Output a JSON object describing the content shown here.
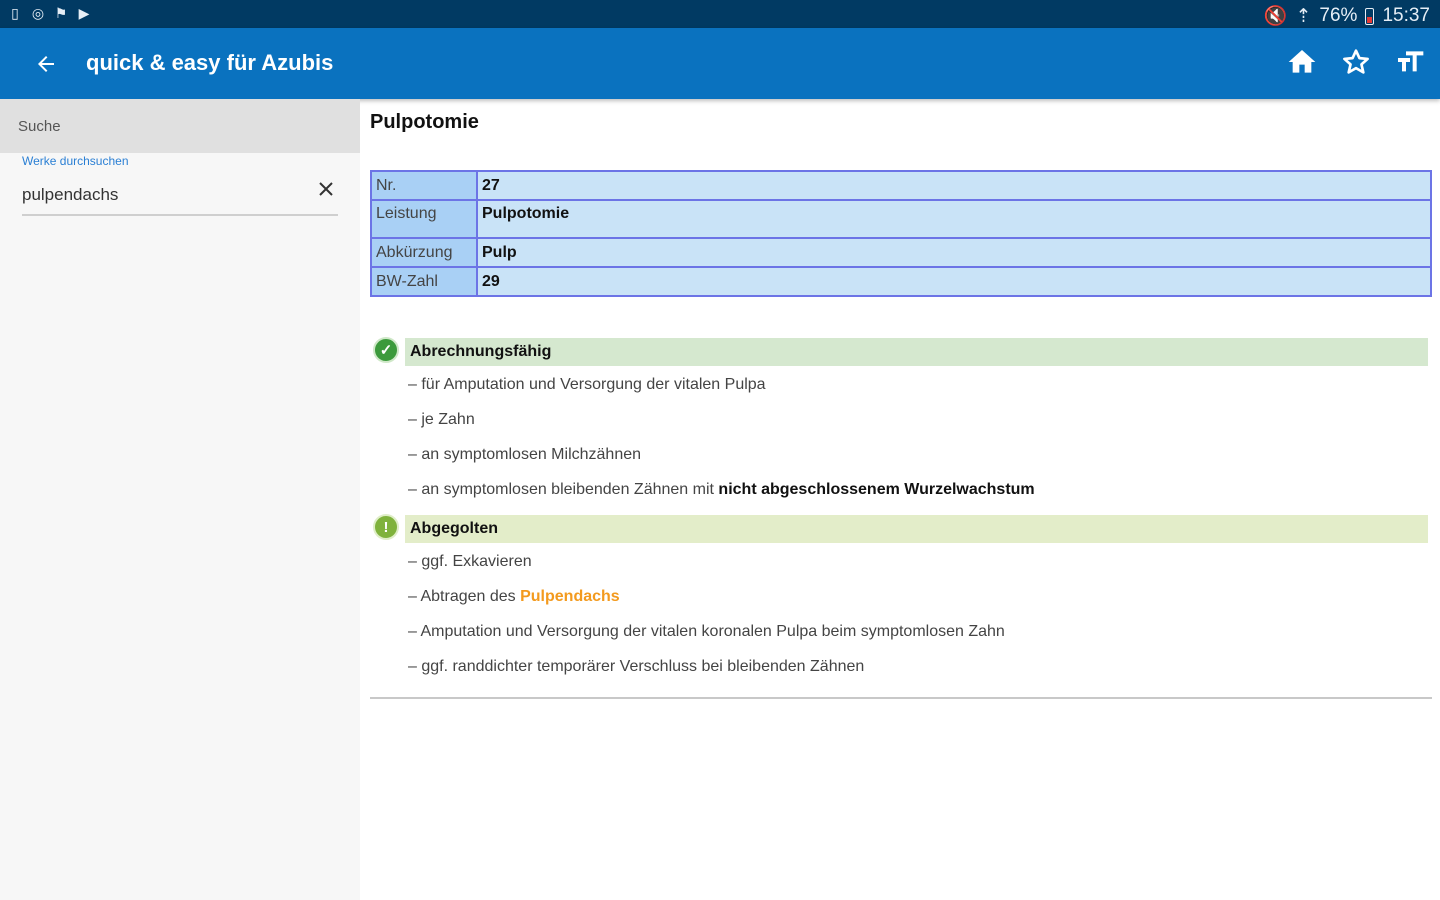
{
  "status_bar": {
    "left_icons": [
      "sim-icon",
      "circle-icon",
      "flag-icon",
      "play-icon"
    ],
    "battery": "76%",
    "time": "15:37"
  },
  "appbar": {
    "title": "quick & easy für Azubis",
    "icons": [
      "home-icon",
      "star-icon",
      "text-size-icon"
    ]
  },
  "sidebar": {
    "search_header": "Suche",
    "search_field_label": "Werke durchsuchen",
    "search_value": "pulpendachs"
  },
  "content": {
    "title": "Pulpotomie",
    "table": [
      {
        "key": "Nr.",
        "value": "27"
      },
      {
        "key": "Leistung",
        "value": "Pulpotomie"
      },
      {
        "key": "Abkürzung",
        "value": "Pulp"
      },
      {
        "key": "BW-Zahl",
        "value": "29"
      }
    ],
    "billable": {
      "heading": "Abrechnungsfähig",
      "items": [
        "für Amputation und Versorgung der vitalen Pulpa",
        "je Zahn",
        "an symptomlosen Milchzähnen"
      ],
      "item4_prefix": "an symptomlosen bleibenden Zähnen mit",
      "item4_bold": "nicht abgeschlossenem Wurzelwachstum"
    },
    "covered": {
      "heading": "Abgegolten",
      "item1": "ggf. Exkavieren",
      "item2_prefix": "Abtragen des",
      "item2_highlight": "Pulpendachs",
      "item3": "Amputation und Versorgung der vitalen koronalen Pulpa beim symptomlosen Zahn",
      "item4": "ggf. randdichter temporärer Verschluss bei bleibenden Zähnen"
    }
  },
  "colors": {
    "appbar": "#0a72bf",
    "statusbar": "#013a63",
    "table_border": "#6c74e6",
    "billable_bar": "#d5e8cf",
    "covered_bar": "#e3edc9",
    "highlight": "#f39a1e"
  }
}
